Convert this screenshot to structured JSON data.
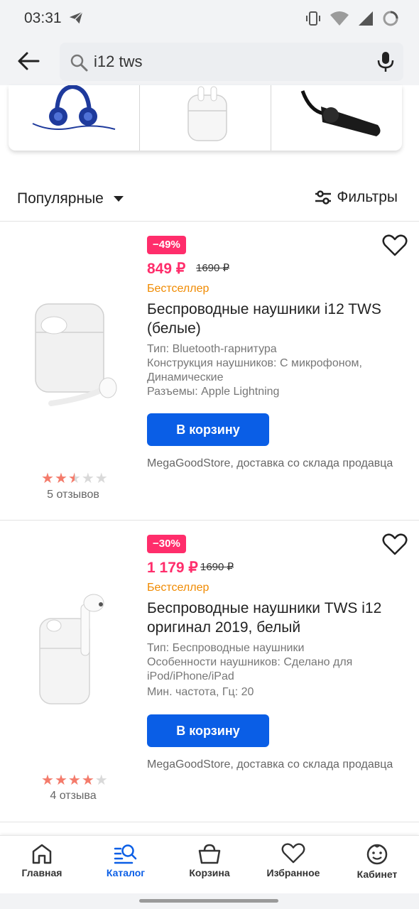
{
  "status_bar": {
    "time": "03:31",
    "icons": [
      "telegram-send-icon",
      "vibrate-icon",
      "wifi-icon",
      "signal-icon",
      "battery-ring-icon"
    ]
  },
  "search": {
    "query": "i12 tws",
    "icons": [
      "back-arrow-icon",
      "search-icon",
      "mic-icon"
    ]
  },
  "categories": [
    {
      "name": "blue-headphones-image"
    },
    {
      "name": "white-earbuds-case-image"
    },
    {
      "name": "black-bluetooth-headset-image"
    }
  ],
  "sort": {
    "label": "Популярные",
    "filter_label": "Фильтры"
  },
  "products": [
    {
      "discount": "−49%",
      "price": "849 ₽",
      "old_price": "1690 ₽",
      "tag": "Бестселлер",
      "title": "Беспроводные наушники i12 TWS (белые)",
      "specs": [
        "Тип: Bluetooth-гарнитура",
        "Конструкция наушников: С микрофоном, Динамические",
        "Разъемы: Apple Lightning"
      ],
      "cart_button": "В корзину",
      "seller": "MegaGoodStore, доставка со склада продавца",
      "rating": 2.5,
      "reviews": "5 отзывов"
    },
    {
      "discount": "−30%",
      "price": "1 179 ₽",
      "old_price": "1690 ₽",
      "tag": "Бестселлер",
      "title": "Беспроводные наушники TWS i12 оригинал 2019, белый",
      "specs": [
        "Тип: Беспроводные наушники",
        "Особенности наушников: Сделано для iPod/iPhone/iPad",
        "Мин. частота, Гц: 20"
      ],
      "cart_button": "В корзину",
      "seller": "MegaGoodStore, доставка со склада продавца",
      "rating": 4,
      "reviews": "4 отзыва"
    }
  ],
  "bottom_nav": [
    {
      "label": "Главная",
      "icon": "home-icon"
    },
    {
      "label": "Каталог",
      "icon": "catalog-search-icon"
    },
    {
      "label": "Корзина",
      "icon": "basket-icon"
    },
    {
      "label": "Избранное",
      "icon": "heart-icon"
    },
    {
      "label": "Кабинет",
      "icon": "smiley-icon"
    }
  ],
  "colors": {
    "accent": "#0a5ee6",
    "sale": "#ff2d6b",
    "bestseller": "#f08a00",
    "star_on": "#f47b6b",
    "star_off": "#d9d9d9"
  }
}
